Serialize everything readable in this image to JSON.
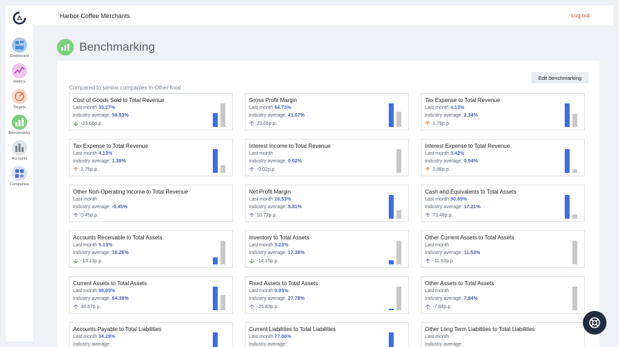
{
  "header": {
    "company": "Harbor Coffee Merchants",
    "logout": "Log out"
  },
  "sidebar": {
    "items": [
      {
        "label": "Dashboard",
        "icon": "dashboard-icon",
        "color": "#a9c8ee"
      },
      {
        "label": "Metrics",
        "icon": "metrics-icon",
        "color": "#efc7ef"
      },
      {
        "label": "Targets",
        "icon": "targets-icon",
        "color": "#f6d9c9"
      },
      {
        "label": "Benchmarks",
        "icon": "benchmarks-icon",
        "color": "#7bd17b",
        "active": true
      },
      {
        "label": "Accounts",
        "icon": "accounts-icon",
        "color": "#dfe3e8"
      },
      {
        "label": "Companies",
        "icon": "companies-icon",
        "color": "#d9e3f6"
      }
    ]
  },
  "page": {
    "title": "Benchmarking",
    "edit_button": "Edit benchmarking",
    "subtitle": "Compared to similar companies in Other food"
  },
  "labels": {
    "last_month": "Last month",
    "industry_average": "Industry average:"
  },
  "colors": {
    "last_month_bar": "#3c6de6",
    "industry_bar": "#c8c8c8",
    "accent_green": "#7bd17b",
    "logout_red": "#d24a2a",
    "up_orange": "#f0883e",
    "down_green": "#3daa4a",
    "neutral_purple": "#8a7fd6"
  },
  "cards": [
    {
      "title": "Cost of Goods Sold to Total Revenue",
      "last_month": "35.27%",
      "industry": "58.93%",
      "diff": "-23.66p.p.",
      "trend": "down",
      "lm": 35.27,
      "ind": 58.93
    },
    {
      "title": "Gross Profit Margin",
      "last_month": "64.73%",
      "industry": "41.07%",
      "diff": "23.66p.p.",
      "trend": "neutral",
      "lm": 64.73,
      "ind": 41.07
    },
    {
      "title": "Tax Expense to Total Revenue",
      "last_month": "4.13%",
      "industry": "2.34%",
      "diff": "1.79p.p.",
      "trend": "up",
      "lm": 4.13,
      "ind": 2.34
    },
    {
      "title": "Tax Expense to Total Revenue",
      "last_month": "4.13%",
      "industry": "1.38%",
      "diff": "2.75p.p.",
      "trend": "up",
      "lm": 4.13,
      "ind": 1.38
    },
    {
      "title": "Interest Income to Total Revenue",
      "last_month": "",
      "industry": "0.02%",
      "diff": "-0.02p.p.",
      "trend": "neutral",
      "lm": 0,
      "ind": 0.02
    },
    {
      "title": "Interest Expense to Total Revenue",
      "last_month": "3.42%",
      "industry": "0.54%",
      "diff": "2.88p.p.",
      "trend": "up",
      "lm": 3.42,
      "ind": 0.54
    },
    {
      "title": "Other Non-Operating Income to Total Revenue",
      "last_month": "",
      "industry": "-0.45%",
      "diff": "0.45p.p.",
      "trend": "neutral",
      "lm": 0,
      "ind": 0
    },
    {
      "title": "Net Profit Margin",
      "last_month": "16.53%",
      "industry": "5.81%",
      "diff": "10.72p.p.",
      "trend": "neutral",
      "lm": 16.53,
      "ind": 5.81
    },
    {
      "title": "Cash and Equivalents to Total Assets",
      "last_month": "90.69%",
      "industry": "17.21%",
      "diff": "73.48p.p.",
      "trend": "neutral",
      "lm": 90.69,
      "ind": 17.21
    },
    {
      "title": "Accounts Receivable to Total Assets",
      "last_month": "5.13%",
      "industry": "18.26%",
      "diff": "-13.13p.p.",
      "trend": "down",
      "lm": 5.13,
      "ind": 18.26
    },
    {
      "title": "Inventory to Total Assets",
      "last_month": "3.23%",
      "industry": "17.38%",
      "diff": "-14.15p.p.",
      "trend": "down",
      "lm": 3.23,
      "ind": 17.38
    },
    {
      "title": "Other Current Assets to Total Assets",
      "last_month": "",
      "industry": "11.53%",
      "diff": "-11.53p.p.",
      "trend": "neutral",
      "lm": 0,
      "ind": 11.53
    },
    {
      "title": "Current Assets to Total Assets",
      "last_month": "99.05%",
      "industry": "64.38%",
      "diff": "34.67p.p.",
      "trend": "neutral",
      "lm": 99.05,
      "ind": 64.38
    },
    {
      "title": "Fixed Assets to Total Assets",
      "last_month": "0.95%",
      "industry": "27.78%",
      "diff": "-26.83p.p.",
      "trend": "neutral",
      "lm": 0.95,
      "ind": 27.78
    },
    {
      "title": "Other Assets to Total Assets",
      "last_month": "",
      "industry": "7.84%",
      "diff": "-7.84p.p.",
      "trend": "neutral",
      "lm": 0,
      "ind": 7.84
    },
    {
      "title": "Accounts Payable to Total Liabilities",
      "last_month": "34.28%",
      "industry": "",
      "diff": "",
      "trend": "neutral",
      "lm": 34.28,
      "ind": 0
    },
    {
      "title": "Current Liabilities to Total Liabilities",
      "last_month": "77.06%",
      "industry": "",
      "diff": "",
      "trend": "neutral",
      "lm": 77.06,
      "ind": 0
    },
    {
      "title": "Other Long Term Liabilities to Total Liabilities",
      "last_month": "",
      "industry": "",
      "diff": "",
      "trend": "neutral",
      "lm": 0,
      "ind": 0
    }
  ]
}
